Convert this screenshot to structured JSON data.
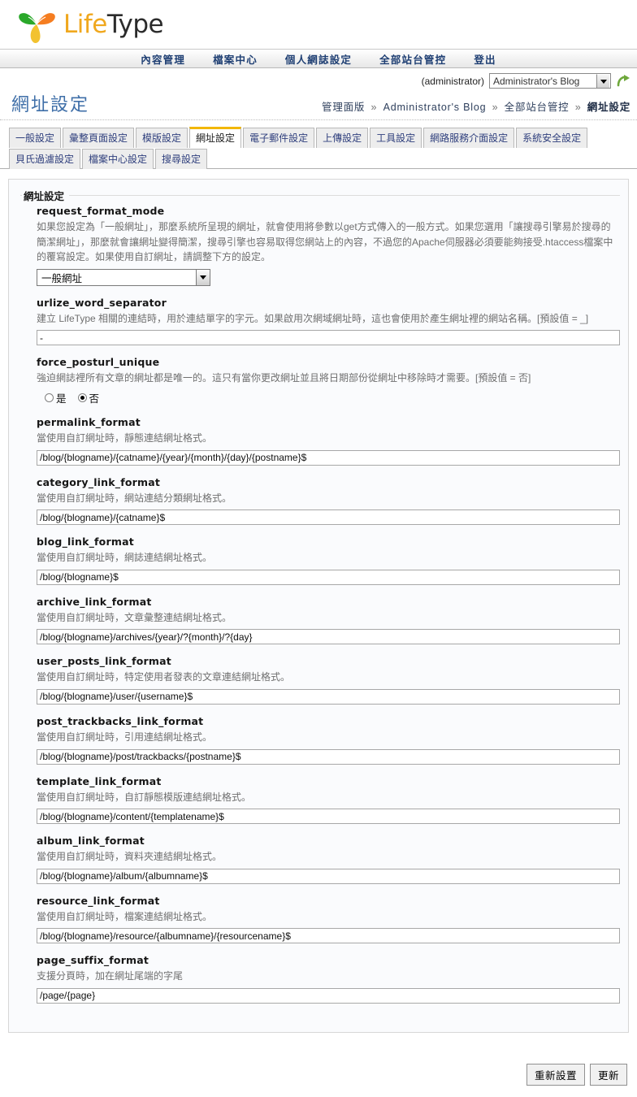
{
  "brand": {
    "name_part1": "Life",
    "name_part2": "Type",
    "logo_icon": "three-leaf-icon",
    "colors": {
      "life": "#f0a81e",
      "type": "#2b2b2b",
      "leaf_green": "#2aa82a",
      "leaf_orange": "#f57d20",
      "leaf_yellow": "#f2c230"
    }
  },
  "nav": {
    "items": [
      {
        "label": "內容管理"
      },
      {
        "label": "檔案中心"
      },
      {
        "label": "個人網誌設定"
      },
      {
        "label": "全部站台管控"
      },
      {
        "label": "登出"
      }
    ]
  },
  "blogbar": {
    "username": "(administrator)",
    "selected_blog": "Administrator's Blog",
    "go_icon": "green-curved-arrow-icon",
    "dropdown_icon": "chevron-down-icon"
  },
  "header": {
    "page_title": "網址設定",
    "breadcrumb": [
      {
        "label": "管理面版",
        "current": false
      },
      {
        "label": "Administrator's Blog",
        "current": false
      },
      {
        "label": "全部站台管控",
        "current": false
      },
      {
        "label": "網址設定",
        "current": true
      }
    ],
    "breadcrumb_separator": "»"
  },
  "tabs": {
    "active_index": 3,
    "items": [
      {
        "label": "一般設定"
      },
      {
        "label": "彙整頁面設定"
      },
      {
        "label": "模版設定"
      },
      {
        "label": "網址設定"
      },
      {
        "label": "電子郵件設定"
      },
      {
        "label": "上傳設定"
      },
      {
        "label": "工具設定"
      },
      {
        "label": "網路服務介面設定"
      },
      {
        "label": "系統安全設定"
      },
      {
        "label": "貝氏過濾設定"
      },
      {
        "label": "檔案中心設定"
      },
      {
        "label": "搜尋設定"
      }
    ]
  },
  "section": {
    "legend": "網址設定",
    "fields": [
      {
        "name": "request_format_mode",
        "desc": "如果您設定為「一般網址」，那麼系統所呈現的網址，就會使用將參數以get方式傳入的一般方式。如果您選用「讓搜尋引擎易於搜尋的簡潔網址」，那麼就會讓網址變得簡潔，搜尋引擎也容易取得您網站上的內容，不過您的Apache伺服器必須要能夠接受.htaccess檔案中的覆寫設定。如果使用自訂網址，請調整下方的設定。",
        "control": "select",
        "value": "一般網址"
      },
      {
        "name": "urlize_word_separator",
        "desc": "建立 LifeType 相關的連結時，用於連結單字的字元。如果啟用次網域網址時，這也會使用於產生網址裡的網站名稱。[預設值 = _]",
        "control": "text",
        "value": "-"
      },
      {
        "name": "force_posturl_unique",
        "desc": "強迫網誌裡所有文章的網址都是唯一的。這只有當你更改網址並且將日期部份從網址中移除時才需要。[預設值 = 否]",
        "control": "radio",
        "options": [
          {
            "label": "是",
            "checked": false
          },
          {
            "label": "否",
            "checked": true
          }
        ]
      },
      {
        "name": "permalink_format",
        "desc": "當使用自訂網址時，靜態連結網址格式。",
        "control": "text",
        "value": "/blog/{blogname}/{catname}/{year}/{month}/{day}/{postname}$"
      },
      {
        "name": "category_link_format",
        "desc": "當使用自訂網址時，網站連結分類網址格式。",
        "control": "text",
        "value": "/blog/{blogname}/{catname}$"
      },
      {
        "name": "blog_link_format",
        "desc": "當使用自訂網址時，網誌連結網址格式。",
        "control": "text",
        "value": "/blog/{blogname}$"
      },
      {
        "name": "archive_link_format",
        "desc": "當使用自訂網址時，文章彙整連結網址格式。",
        "control": "text",
        "value": "/blog/{blogname}/archives/{year}/?{month}/?{day}"
      },
      {
        "name": "user_posts_link_format",
        "desc": "當使用自訂網址時，特定使用者發表的文章連結網址格式。",
        "control": "text",
        "value": "/blog/{blogname}/user/{username}$"
      },
      {
        "name": "post_trackbacks_link_format",
        "desc": "當使用自訂網址時，引用連結網址格式。",
        "control": "text",
        "value": "/blog/{blogname}/post/trackbacks/{postname}$"
      },
      {
        "name": "template_link_format",
        "desc": "當使用自訂網址時，自訂靜態模版連結網址格式。",
        "control": "text",
        "value": "/blog/{blogname}/content/{templatename}$"
      },
      {
        "name": "album_link_format",
        "desc": "當使用自訂網址時，資料夾連結網址格式。",
        "control": "text",
        "value": "/blog/{blogname}/album/{albumname}$"
      },
      {
        "name": "resource_link_format",
        "desc": "當使用自訂網址時，檔案連結網址格式。",
        "control": "text",
        "value": "/blog/{blogname}/resource/{albumname}/{resourcename}$"
      },
      {
        "name": "page_suffix_format",
        "desc": "支援分頁時，加在網址尾端的字尾",
        "control": "text",
        "value": "/page/{page}"
      }
    ]
  },
  "footer": {
    "reset_label": "重新設置",
    "update_label": "更新"
  }
}
